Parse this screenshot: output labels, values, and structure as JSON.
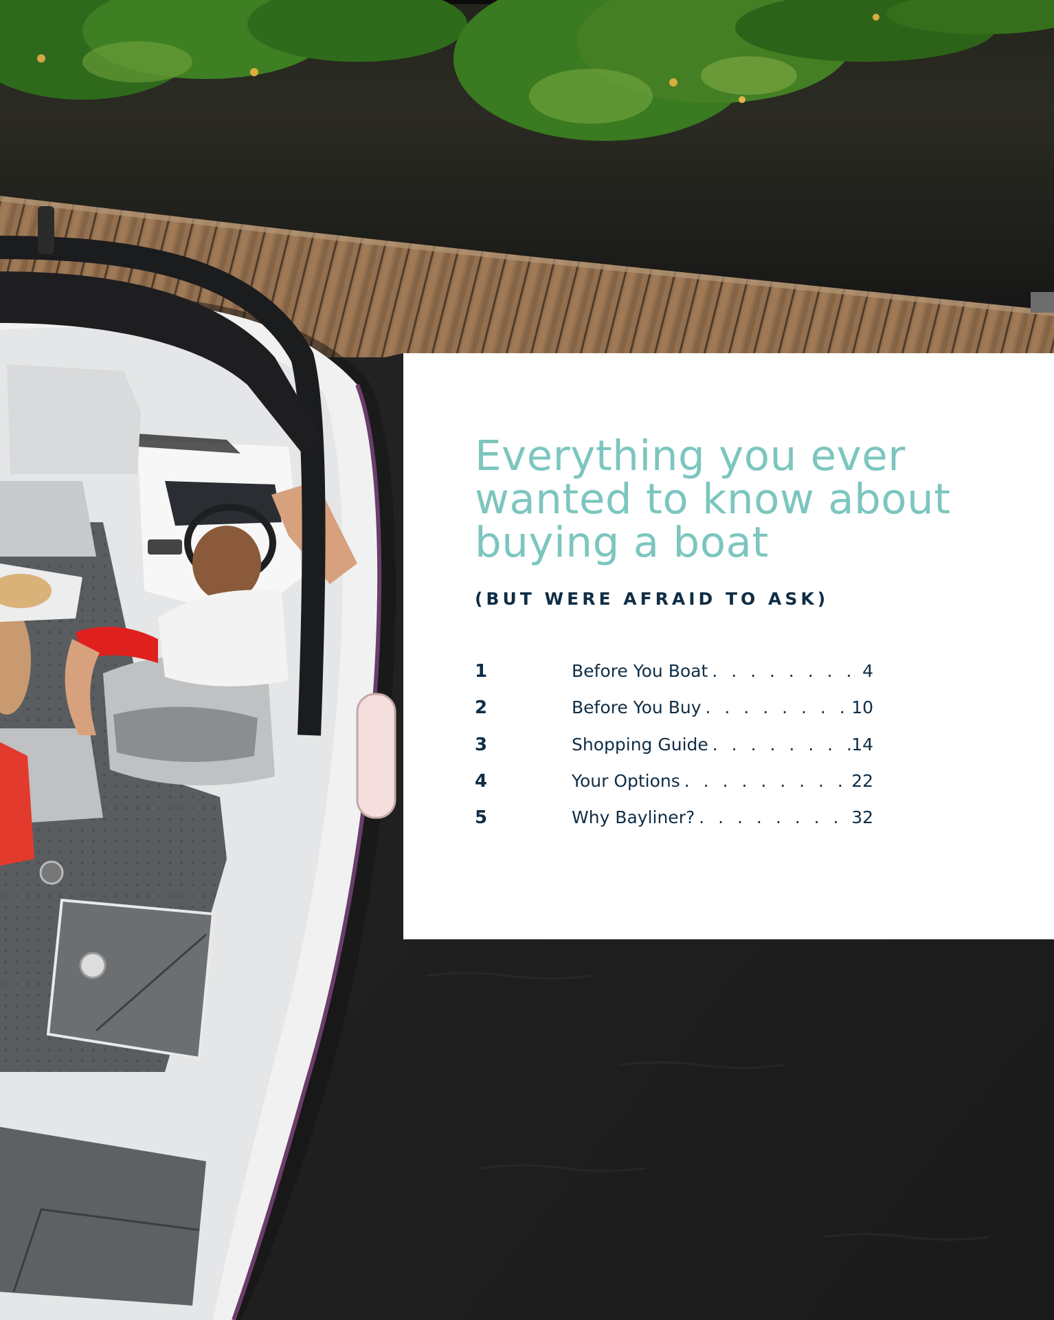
{
  "headline": "Everything you ever wanted to know about buying a boat",
  "subhead": "(BUT WERE AFRAID TO ASK)",
  "toc": [
    {
      "number": "1",
      "title": "Before You Boat",
      "page": "4"
    },
    {
      "number": "2",
      "title": "Before You Buy",
      "page": "10"
    },
    {
      "number": "3",
      "title": "Shopping Guide",
      "page": "14"
    },
    {
      "number": "4",
      "title": "Your Options",
      "page": "22"
    },
    {
      "number": "5",
      "title": "Why Bayliner?",
      "page": "32"
    }
  ],
  "colors": {
    "headline": "#7cc6bf",
    "text": "#0f2d45",
    "card": "#ffffff",
    "water": "#1d1d1d",
    "dock": "#8a6a4c",
    "foliage": "#3f7a22",
    "boat_hull": "#f2f2f2"
  }
}
